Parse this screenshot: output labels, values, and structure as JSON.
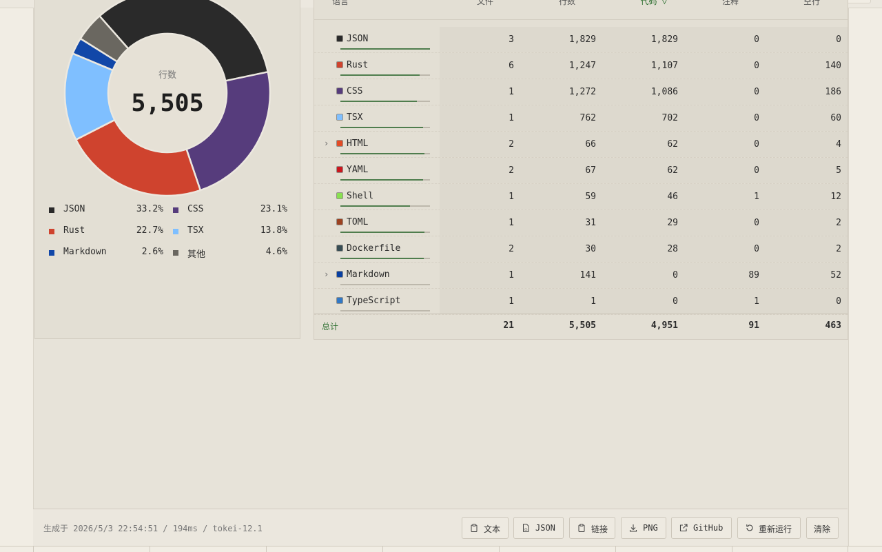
{
  "chart_data": {
    "type": "pie",
    "title": "",
    "center_label": "行数",
    "center_value": "5,505",
    "slices": [
      {
        "name": "JSON",
        "value": 33.2,
        "color": "#2a2a2a"
      },
      {
        "name": "CSS",
        "value": 23.1,
        "color": "#563c7c"
      },
      {
        "name": "Rust",
        "value": 22.7,
        "color": "#cf432e"
      },
      {
        "name": "TSX",
        "value": 13.8,
        "color": "#7fbfff"
      },
      {
        "name": "Markdown",
        "value": 2.6,
        "color": "#1147a8"
      },
      {
        "name": "其他",
        "value": 4.6,
        "color": "#6a6760"
      }
    ]
  },
  "legend": [
    {
      "name": "JSON",
      "pct": "33.2%",
      "color": "#2a2a2a"
    },
    {
      "name": "CSS",
      "pct": "23.1%",
      "color": "#563c7c"
    },
    {
      "name": "Rust",
      "pct": "22.7%",
      "color": "#cf432e"
    },
    {
      "name": "TSX",
      "pct": "13.8%",
      "color": "#7fbfff"
    },
    {
      "name": "Markdown",
      "pct": "2.6%",
      "color": "#1147a8"
    },
    {
      "name": "其他",
      "pct": "4.6%",
      "color": "#6a6760"
    }
  ],
  "table": {
    "headers": {
      "language": "语言",
      "files": "文件",
      "lines": "行数",
      "code": "代码 ▽",
      "comments": "注释",
      "blanks": "空行"
    },
    "rows": [
      {
        "name": "JSON",
        "color": "#2a2a2a",
        "files": "3",
        "lines": "1,829",
        "code": "1,829",
        "comments": "0",
        "blanks": "0",
        "expandable": false,
        "code_share": 1.0
      },
      {
        "name": "Rust",
        "color": "#cf432e",
        "files": "6",
        "lines": "1,247",
        "code": "1,107",
        "comments": "0",
        "blanks": "140",
        "expandable": false,
        "code_share": 0.888
      },
      {
        "name": "CSS",
        "color": "#563c7c",
        "files": "1",
        "lines": "1,272",
        "code": "1,086",
        "comments": "0",
        "blanks": "186",
        "expandable": false,
        "code_share": 0.854
      },
      {
        "name": "TSX",
        "color": "#7fbfff",
        "files": "1",
        "lines": "762",
        "code": "702",
        "comments": "0",
        "blanks": "60",
        "expandable": false,
        "code_share": 0.921
      },
      {
        "name": "HTML",
        "color": "#e34c26",
        "files": "2",
        "lines": "66",
        "code": "62",
        "comments": "0",
        "blanks": "4",
        "expandable": true,
        "code_share": 0.939
      },
      {
        "name": "YAML",
        "color": "#cb171e",
        "files": "2",
        "lines": "67",
        "code": "62",
        "comments": "0",
        "blanks": "5",
        "expandable": false,
        "code_share": 0.925
      },
      {
        "name": "Shell",
        "color": "#89e051",
        "files": "1",
        "lines": "59",
        "code": "46",
        "comments": "1",
        "blanks": "12",
        "expandable": false,
        "code_share": 0.78
      },
      {
        "name": "TOML",
        "color": "#9c4221",
        "files": "1",
        "lines": "31",
        "code": "29",
        "comments": "0",
        "blanks": "2",
        "expandable": false,
        "code_share": 0.935
      },
      {
        "name": "Dockerfile",
        "color": "#384d54",
        "files": "2",
        "lines": "30",
        "code": "28",
        "comments": "0",
        "blanks": "2",
        "expandable": false,
        "code_share": 0.933
      },
      {
        "name": "Markdown",
        "color": "#083fa1",
        "files": "1",
        "lines": "141",
        "code": "0",
        "comments": "89",
        "blanks": "52",
        "expandable": true,
        "code_share": 0.0
      },
      {
        "name": "TypeScript",
        "color": "#3178c6",
        "files": "1",
        "lines": "1",
        "code": "0",
        "comments": "1",
        "blanks": "0",
        "expandable": false,
        "code_share": 0.0
      }
    ],
    "total": {
      "label": "总计",
      "files": "21",
      "lines": "5,505",
      "code": "4,951",
      "comments": "91",
      "blanks": "463"
    }
  },
  "footer": {
    "generated": "生成于 2026/5/3 22:54:51 / 194ms / tokei-12.1",
    "buttons": {
      "text": "文本",
      "json": "JSON",
      "link": "链接",
      "png": "PNG",
      "github": "GitHub",
      "rerun": "重新运行",
      "clear": "清除"
    }
  }
}
